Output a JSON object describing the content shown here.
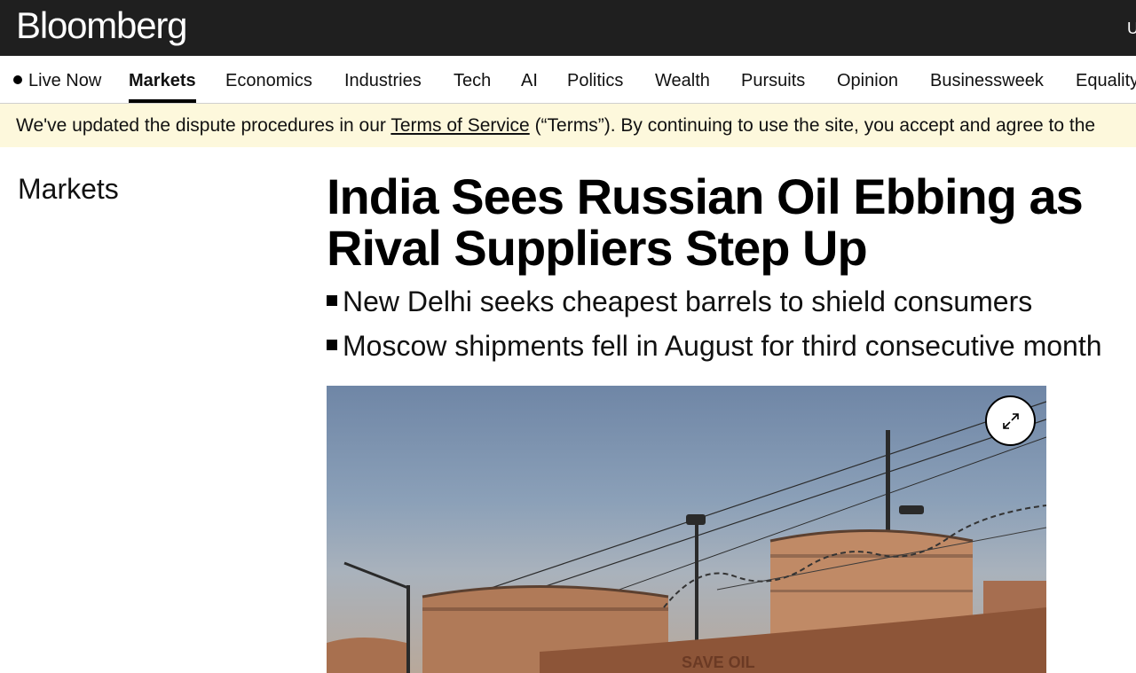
{
  "header": {
    "logo": "Bloomberg",
    "right_cutoff": "U"
  },
  "nav": {
    "items": [
      {
        "label": "Live Now",
        "live": true
      },
      {
        "label": "Markets",
        "active": true
      },
      {
        "label": "Economics"
      },
      {
        "label": "Industries"
      },
      {
        "label": "Tech"
      },
      {
        "label": "AI"
      },
      {
        "label": "Politics"
      },
      {
        "label": "Wealth"
      },
      {
        "label": "Pursuits"
      },
      {
        "label": "Opinion"
      },
      {
        "label": "Businessweek"
      },
      {
        "label": "Equality"
      }
    ]
  },
  "banner": {
    "before": "We've updated the dispute procedures in our ",
    "link": "Terms of Service",
    "after": " (“Terms”). By continuing to use the site, you accept and agree to the"
  },
  "article": {
    "section": "Markets",
    "headline": "India Sees Russian Oil Ebbing as Rival Suppliers Step Up",
    "bullets": [
      "New Delhi seeks cheapest barrels to shield consumers",
      "Moscow shipments fell in August for third consecutive month"
    ],
    "image": {
      "expand_icon": "expand-icon",
      "tank_sign": "SAVE OIL"
    }
  },
  "colors": {
    "topbar": "#1f1f1f",
    "banner": "#fdf8dc"
  }
}
